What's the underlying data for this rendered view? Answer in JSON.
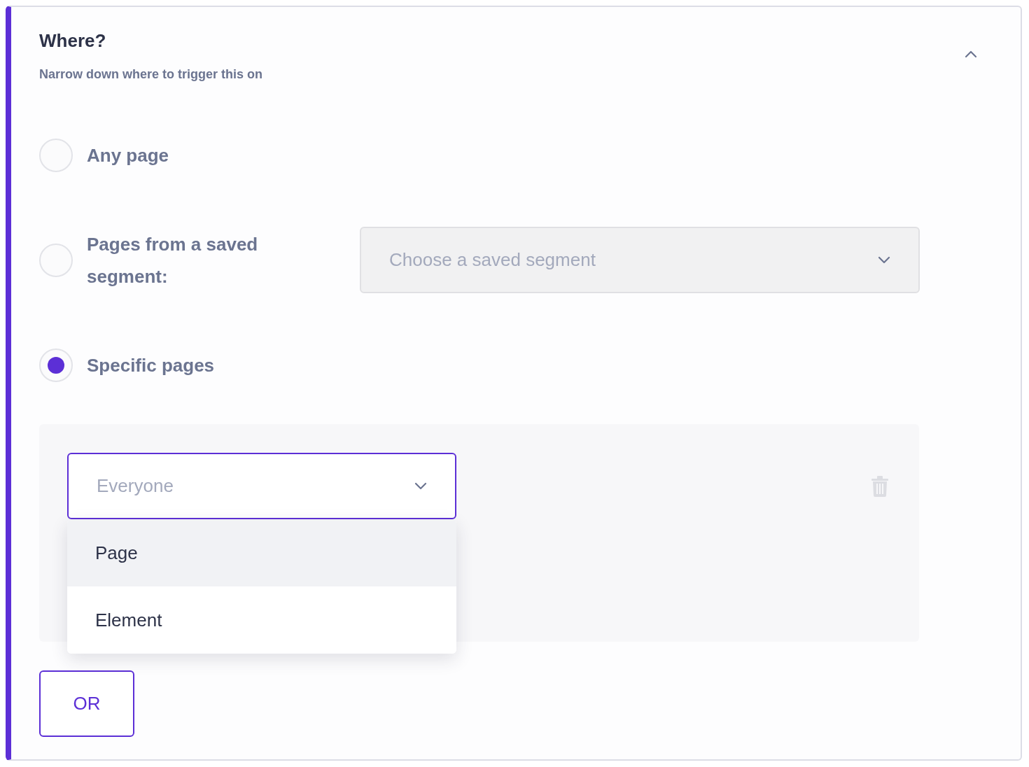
{
  "section": {
    "title": "Where?",
    "subtitle": "Narrow down where to trigger this on",
    "expanded": true
  },
  "options": [
    {
      "kind": "plain",
      "label": "Any page",
      "selected": false
    },
    {
      "kind": "segment",
      "label": "Pages from a saved segment:",
      "selected": false,
      "select": {
        "placeholder": "Choose a saved segment",
        "disabled": true
      }
    },
    {
      "kind": "plain",
      "label": "Specific pages",
      "selected": true
    }
  ],
  "rule": {
    "select": {
      "placeholder": "Everyone",
      "open": true
    },
    "menu": [
      {
        "label": "Page",
        "selected": true
      },
      {
        "label": "Element",
        "selected": false
      }
    ]
  },
  "or_button": "OR"
}
